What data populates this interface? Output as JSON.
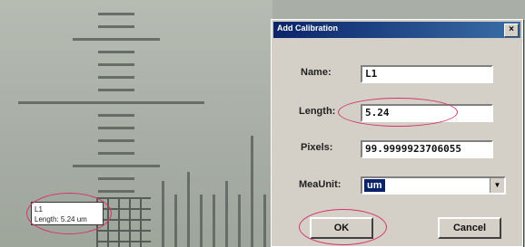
{
  "dialog": {
    "title": "Add Calibration",
    "close_symbol": "×",
    "fields": {
      "name_label": "Name:",
      "name_value": "L1",
      "length_label": "Length:",
      "length_value": "5.24",
      "pixels_label": "Pixels:",
      "pixels_value": "99.9999923706055",
      "meaunit_label": "MeaUnit:",
      "meaunit_value": "um"
    },
    "ok_label": "OK",
    "cancel_label": "Cancel"
  },
  "image_annotation": {
    "name": "L1",
    "length_text": "Length: 5.24 um"
  },
  "colors": {
    "highlight_ellipse": "#d6336c",
    "titlebar": "#0a246a"
  },
  "icons": [
    "close-icon",
    "dropdown-arrow-icon"
  ]
}
